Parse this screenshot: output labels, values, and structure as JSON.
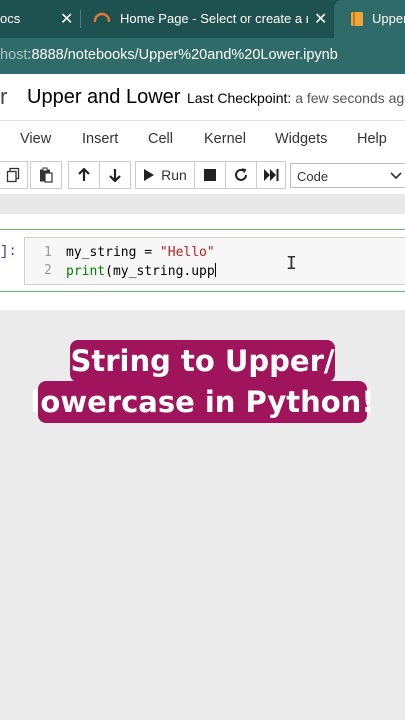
{
  "browser": {
    "tabs": [
      {
        "label": "ocs"
      },
      {
        "label": "Home Page - Select or create a n"
      },
      {
        "label": "Upper"
      }
    ],
    "url_prefix": "host",
    "url_rest": ":8888/notebooks/Upper%20and%20Lower.ipynb"
  },
  "jupyter": {
    "logo_fragment": "r",
    "notebook_title": "Upper and Lower",
    "checkpoint_label": "Last Checkpoint:",
    "checkpoint_value": "a few seconds ago"
  },
  "menu": {
    "items": [
      "View",
      "Insert",
      "Cell",
      "Kernel",
      "Widgets",
      "Help"
    ]
  },
  "toolbar": {
    "run_label": "Run",
    "cell_type": "Code"
  },
  "cell": {
    "prompt": "]:",
    "line_numbers": [
      "1",
      "2"
    ],
    "line1": {
      "var": "my_string = ",
      "str": "\"Hello\""
    },
    "line2": {
      "fn": "print",
      "rest": "(my_string.upp"
    }
  },
  "caption": {
    "line1": "String to Upper/",
    "line2": "lowercase in Python!"
  },
  "colors": {
    "tab_strip": "#1e5250",
    "address_bar": "#2f6b69",
    "caption_bg": "#a0145c",
    "cell_border": "#66bb6a"
  }
}
